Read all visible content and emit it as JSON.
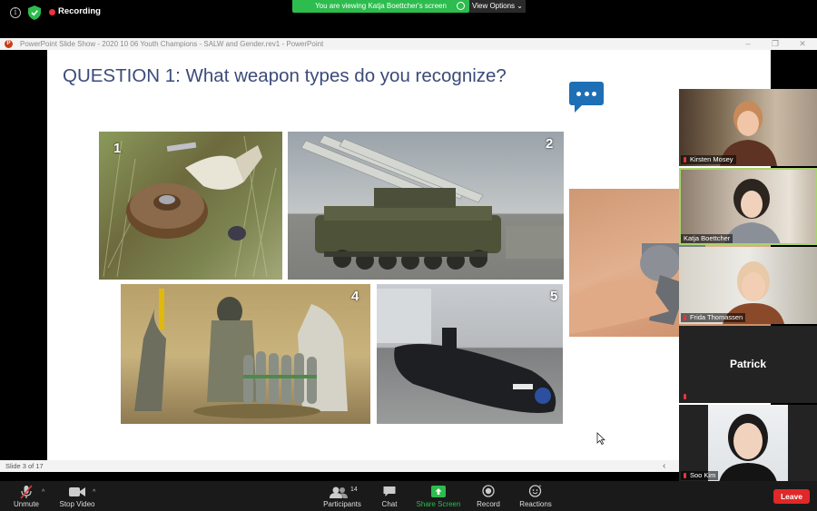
{
  "top_bar": {
    "recording_label": "Recording",
    "viewing_banner": "You are viewing Katja Boettcher's screen",
    "view_options": "View Options"
  },
  "ppt": {
    "window_title": "PowerPoint Slide Show  -  2020 10 06 Youth Champions - SALW and Gender.rev1  -  PowerPoint",
    "slide_heading": "QUESTION 1: What weapon types do you recognize?",
    "pictures": [
      {
        "number": "1"
      },
      {
        "number": "2"
      },
      {
        "number": "4"
      },
      {
        "number": "5"
      }
    ],
    "status": "Slide 3 of 17"
  },
  "participants_panel": [
    {
      "name": "Kirsten Mosey",
      "muted": true
    },
    {
      "name": "Katja Boettcher",
      "muted": false,
      "active": true
    },
    {
      "name": "Frida Thomassen",
      "muted": true
    },
    {
      "name": "Patrick",
      "muted": true
    },
    {
      "name": "Soo Kim",
      "muted": true
    }
  ],
  "toolbar": {
    "unmute": "Unmute",
    "stop_video": "Stop Video",
    "participants": "Participants",
    "participants_count": "14",
    "chat": "Chat",
    "share_screen": "Share Screen",
    "record": "Record",
    "reactions": "Reactions",
    "leave": "Leave"
  },
  "colors": {
    "accent_green": "#2dbc4e",
    "leave_red": "#e02828",
    "slide_heading": "#3b4a7a",
    "active_speaker_outline": "#a9d36d"
  }
}
